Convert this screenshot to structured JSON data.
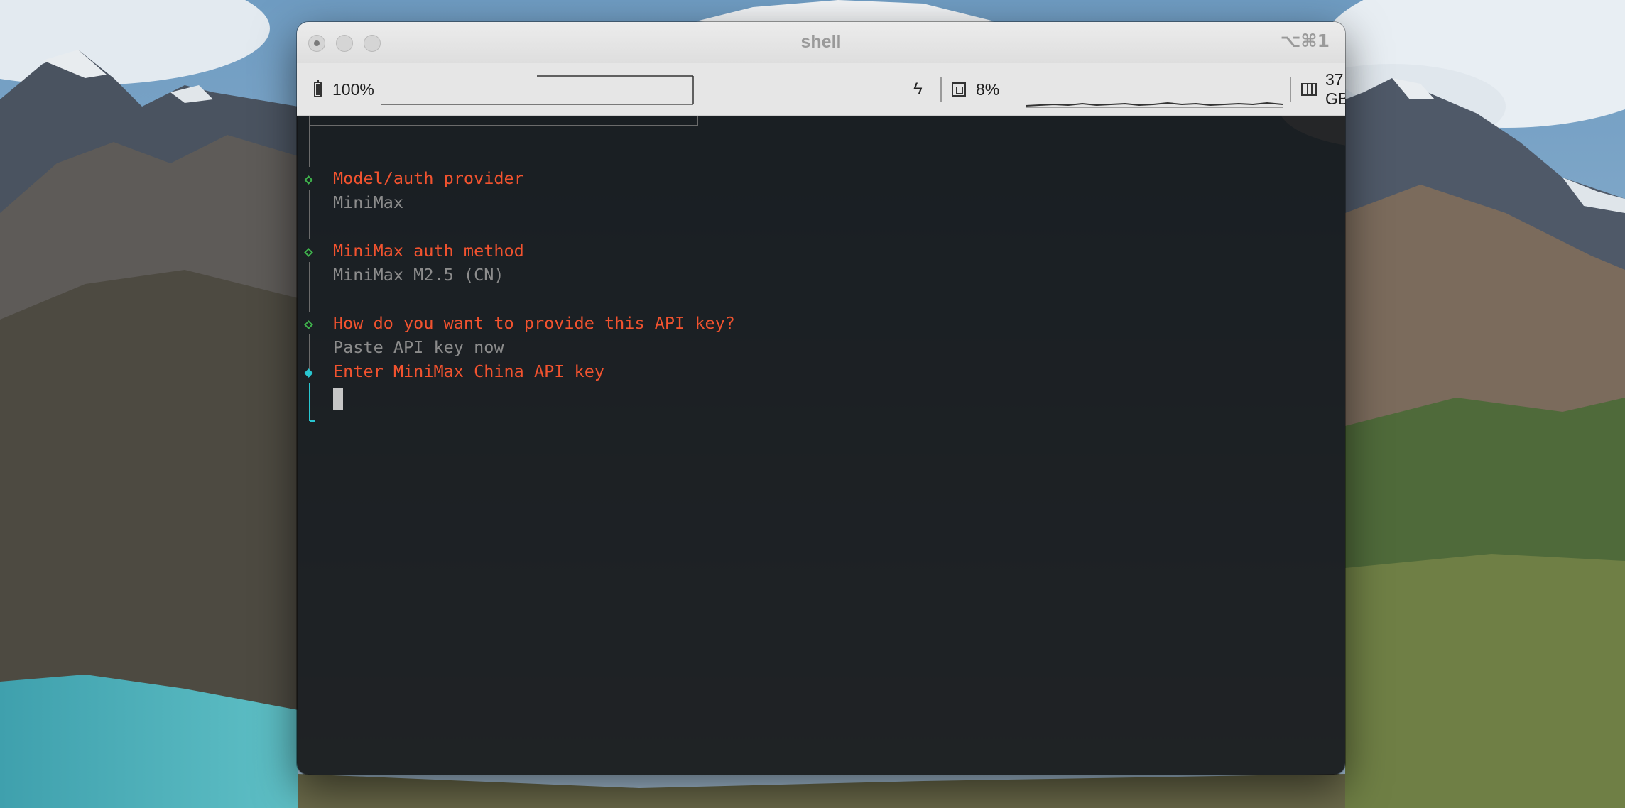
{
  "window": {
    "title": "shell",
    "shortcut": "⌥⌘1"
  },
  "statusbar": {
    "battery": {
      "icon": "battery-icon",
      "value": "100%",
      "charging_icon": "bolt-icon"
    },
    "cpu": {
      "icon": "cpu-icon",
      "value": "8%"
    },
    "memory": {
      "icon": "memory-icon",
      "value": "37 GB"
    }
  },
  "terminal": {
    "steps": [
      {
        "status": "done",
        "question": "Model/auth provider",
        "answer": "MiniMax"
      },
      {
        "status": "done",
        "question": "MiniMax auth method",
        "answer": "MiniMax M2.5 (CN)"
      },
      {
        "status": "done",
        "question": "How do you want to provide this API key?",
        "answer": "Paste API key now"
      },
      {
        "status": "active",
        "question": "Enter MiniMax China API key",
        "answer": ""
      }
    ]
  },
  "colors": {
    "question": "#f2532f",
    "answer": "#8c8c8c",
    "done_marker": "#3fb24c",
    "active_marker": "#29c6d0"
  }
}
